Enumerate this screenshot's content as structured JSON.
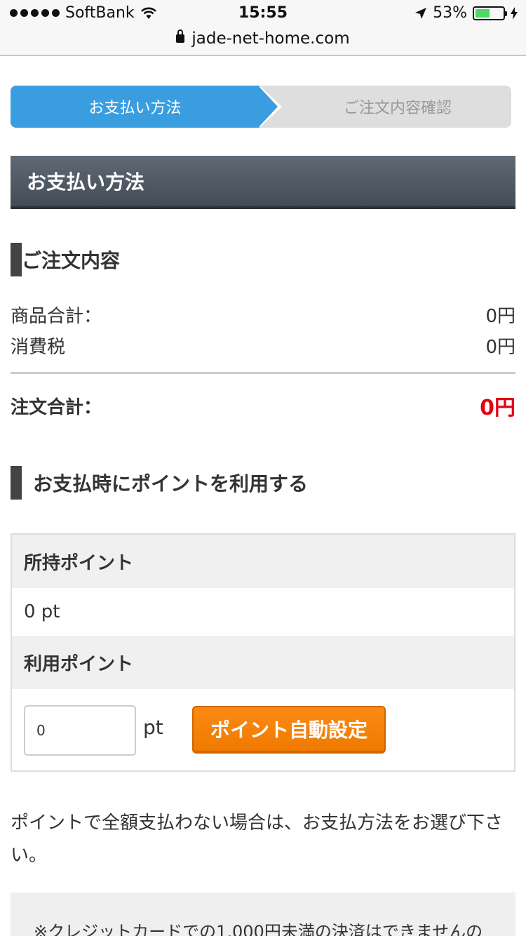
{
  "status_bar": {
    "carrier": "SoftBank",
    "time": "15:55",
    "battery": "53%",
    "battery_level": 0.53
  },
  "browser": {
    "url": "jade-net-home.com"
  },
  "steps": {
    "active": "お支払い方法",
    "next": "ご注文内容確認"
  },
  "page_title": "お支払い方法",
  "order": {
    "heading": "ご注文内容",
    "subtotal_label": "商品合計：",
    "subtotal_value": "0円",
    "tax_label": "消費税",
    "tax_value": "0円",
    "total_label": "注文合計：",
    "total_value": "0円",
    "total_color": "#e60012"
  },
  "points": {
    "heading": "お支払時にポイントを利用する",
    "held_label": "所持ポイント",
    "held_value": "0 pt",
    "use_label": "利用ポイント",
    "use_input_value": "0",
    "use_unit": "pt",
    "auto_button": "ポイント自動設定",
    "button_color": "#f07a00"
  },
  "note": "ポイントで全額支払わない場合は、お支払方法をお選び下さい。",
  "credit_note": "※クレジットカードでの1,000円未満の決済はできませんの"
}
